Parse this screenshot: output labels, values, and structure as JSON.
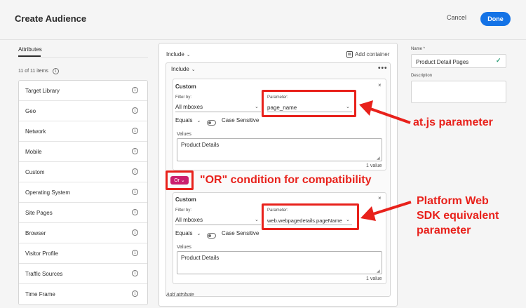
{
  "header": {
    "title": "Create Audience",
    "cancel_label": "Cancel",
    "done_label": "Done"
  },
  "sidebar": {
    "tab_label": "Attributes",
    "count_label": "11 of 11 items",
    "items": [
      {
        "label": "Target Library"
      },
      {
        "label": "Geo"
      },
      {
        "label": "Network"
      },
      {
        "label": "Mobile"
      },
      {
        "label": "Custom"
      },
      {
        "label": "Operating System"
      },
      {
        "label": "Site Pages"
      },
      {
        "label": "Browser"
      },
      {
        "label": "Visitor Profile"
      },
      {
        "label": "Traffic Sources"
      },
      {
        "label": "Time Frame"
      }
    ]
  },
  "builder": {
    "include_label": "Include",
    "add_container_label": "Add container",
    "inner_include_label": "Include",
    "more_label": "•••",
    "or_label": "Or",
    "add_attribute_label": "Add attribute",
    "cards": [
      {
        "title": "Custom",
        "close": "×",
        "filter_by_label": "Filter by:",
        "filter_value": "All mboxes",
        "parameter_label": "Parameter:",
        "parameter_value": "page_name",
        "operator": "Equals",
        "case_sensitive_label": "Case Sensitive",
        "values_label": "Values",
        "value": "Product Details",
        "value_count": "1 value"
      },
      {
        "title": "Custom",
        "close": "×",
        "filter_by_label": "Filter by:",
        "filter_value": "All mboxes",
        "parameter_label": "Parameter:",
        "parameter_value": "web.webpagedetails.pageName",
        "operator": "Equals",
        "case_sensitive_label": "Case Sensitive",
        "values_label": "Values",
        "value": "Product Details",
        "value_count": "1 value"
      }
    ]
  },
  "details": {
    "name_label": "Name *",
    "name_value": "Product Detail Pages",
    "description_label": "Description"
  },
  "annotations": {
    "atjs": "at.js parameter",
    "or_condition": "\"OR\" condition for compatibility",
    "platform_line1": "Platform Web",
    "platform_line2": "SDK equivalent",
    "platform_line3": "parameter"
  },
  "colors": {
    "accent": "#1473e6",
    "or_badge": "#cb1f6e",
    "annotation": "#e8211b",
    "check": "#2d9d78"
  }
}
